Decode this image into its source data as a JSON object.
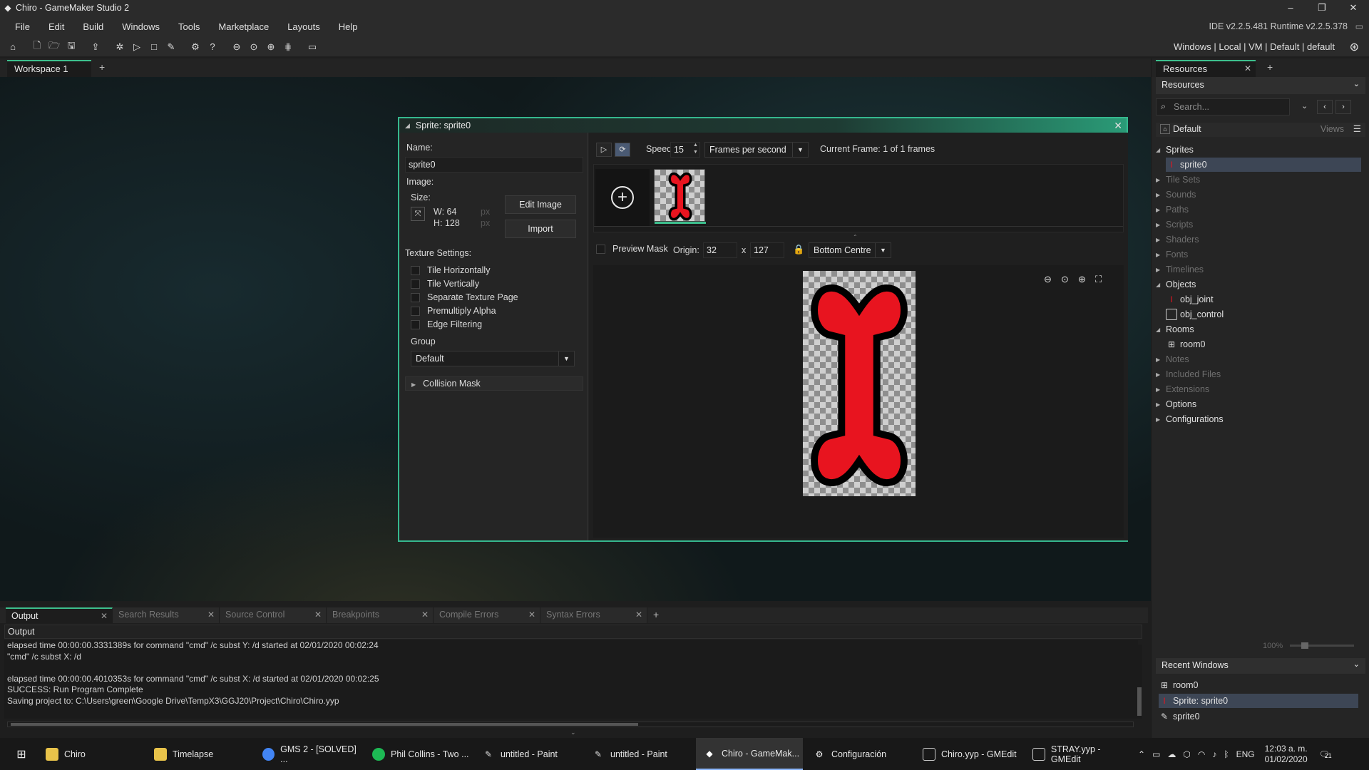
{
  "window": {
    "title": "Chiro - GameMaker Studio 2",
    "min": "–",
    "restore": "❐",
    "close": "✕"
  },
  "menu": [
    "File",
    "Edit",
    "Build",
    "Windows",
    "Tools",
    "Marketplace",
    "Layouts",
    "Help"
  ],
  "ide_version": "IDE v2.2.5.481  Runtime v2.2.5.378",
  "target": "Windows  |  Local  |  VM  |  Default  |  default",
  "workspace_tab": "Workspace 1",
  "sprite_editor": {
    "title": "Sprite: sprite0",
    "name_label": "Name:",
    "name_value": "sprite0",
    "image_label": "Image:",
    "size_label": "Size:",
    "width": "W: 64",
    "height": "H: 128",
    "unit": "px",
    "edit_image": "Edit Image",
    "import": "Import",
    "texture_settings": "Texture Settings:",
    "checkboxes": [
      "Tile Horizontally",
      "Tile Vertically",
      "Separate Texture Page",
      "Premultiply Alpha",
      "Edge Filtering"
    ],
    "group_label": "Group",
    "group_value": "Default",
    "collision_mask": "Collision Mask",
    "speed_label": "Speed:",
    "speed_value": "15",
    "speed_unit": "Frames per second",
    "current_frame": "Current Frame: 1 of 1 frames",
    "preview_mask": "Preview Mask",
    "origin_label": "Origin:",
    "origin_x": "32",
    "origin_sep": "x",
    "origin_y": "127",
    "origin_preset": "Bottom Centre"
  },
  "bottom_tabs": [
    "Output",
    "Search Results",
    "Source Control",
    "Breakpoints",
    "Compile Errors",
    "Syntax Errors"
  ],
  "output_title": "Output",
  "output_lines": [
    "elapsed time 00:00:00.3331389s for command \"cmd\" /c subst Y: /d started at 02/01/2020 00:02:24",
    "\"cmd\"  /c subst X: /d",
    "",
    "elapsed time 00:00:00.4010353s for command \"cmd\" /c subst X: /d started at 02/01/2020 00:02:25",
    "SUCCESS: Run Program Complete",
    "Saving project to: C:\\Users\\green\\Google Drive\\TempX3\\GGJ20\\Project\\Chiro\\Chiro.yyp"
  ],
  "resources": {
    "tab": "Resources",
    "header": "Resources",
    "search_placeholder": "Search...",
    "view": "Default",
    "views_label": "Views",
    "tree": [
      {
        "label": "Sprites",
        "state": "open",
        "bright": true
      },
      {
        "label": "sprite0",
        "child": true,
        "icon": "sprite",
        "selected": true
      },
      {
        "label": "Tile Sets",
        "state": "closed"
      },
      {
        "label": "Sounds",
        "state": "closed"
      },
      {
        "label": "Paths",
        "state": "closed"
      },
      {
        "label": "Scripts",
        "state": "closed"
      },
      {
        "label": "Shaders",
        "state": "closed"
      },
      {
        "label": "Fonts",
        "state": "closed"
      },
      {
        "label": "Timelines",
        "state": "closed"
      },
      {
        "label": "Objects",
        "state": "open",
        "bright": true
      },
      {
        "label": "obj_joint",
        "child": true,
        "icon": "sprite"
      },
      {
        "label": "obj_control",
        "child": true,
        "icon": "object"
      },
      {
        "label": "Rooms",
        "state": "open",
        "bright": true
      },
      {
        "label": "room0",
        "child": true,
        "icon": "room"
      },
      {
        "label": "Notes",
        "state": "closed"
      },
      {
        "label": "Included Files",
        "state": "closed"
      },
      {
        "label": "Extensions",
        "state": "closed"
      },
      {
        "label": "Options",
        "state": "closed",
        "bright": true
      },
      {
        "label": "Configurations",
        "state": "closed",
        "bright": true
      }
    ],
    "zoom": "100%",
    "recent_title": "Recent Windows",
    "recent": [
      {
        "label": "room0",
        "icon": "room"
      },
      {
        "label": "Sprite: sprite0",
        "icon": "sprite",
        "selected": true
      },
      {
        "label": "sprite0",
        "icon": "brush"
      }
    ]
  },
  "taskbar": {
    "items": [
      "Chiro",
      "Timelapse",
      "GMS 2 - [SOLVED] ...",
      "Phil Collins - Two ...",
      "untitled - Paint",
      "untitled - Paint",
      "Chiro - GameMak...",
      "Configuración",
      "Chiro.yyp - GMEdit",
      "STRAY.yyp - GMEdit"
    ],
    "lang": "ENG",
    "time": "12:03 a. m.",
    "date": "01/02/2020",
    "notifications": "21"
  },
  "colors": {
    "accent": "#3dbf8d",
    "bone": "#e8141f",
    "selection": "#3d4655"
  }
}
